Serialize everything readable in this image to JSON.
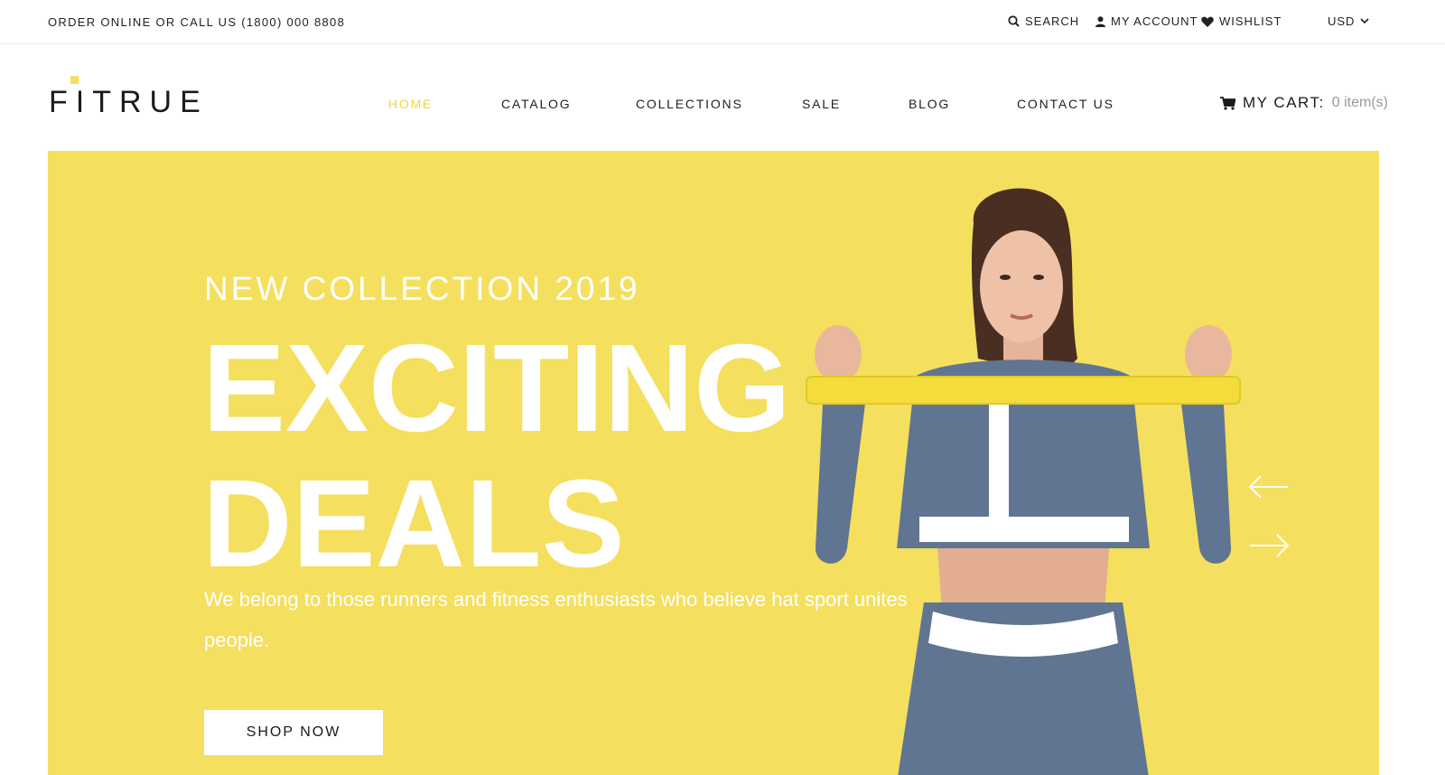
{
  "topbar": {
    "contact": "ORDER ONLINE OR CALL US (1800) 000 8808",
    "search_label": "SEARCH",
    "account_label": "MY ACCOUNT",
    "wishlist_label": "WISHLIST",
    "currency": "USD"
  },
  "brand": {
    "logo_text": "FITRUE",
    "accent_color": "#f5df5e"
  },
  "nav": {
    "items": [
      {
        "label": "HOME",
        "active": true
      },
      {
        "label": "CATALOG",
        "active": false
      },
      {
        "label": "COLLECTIONS",
        "active": false
      },
      {
        "label": "SALE",
        "active": false
      },
      {
        "label": "BLOG",
        "active": false
      },
      {
        "label": "CONTACT US",
        "active": false
      }
    ]
  },
  "cart": {
    "label": "MY CART:",
    "count": "0 item(s)"
  },
  "hero": {
    "kicker": "NEW COLLECTION 2019",
    "headline_line1": "EXCITING",
    "headline_line2": "DEALS",
    "subtitle": "We belong to those runners and fitness enthusiasts who believe hat sport unites people.",
    "button_label": "SHOP NOW",
    "background_color": "#f5df5e"
  },
  "icons": {
    "search": "search-icon",
    "account": "user-icon",
    "wishlist": "heart-icon",
    "currency": "chevron-down-icon",
    "cart": "cart-icon",
    "prev": "arrow-left-icon",
    "next": "arrow-right-icon"
  }
}
